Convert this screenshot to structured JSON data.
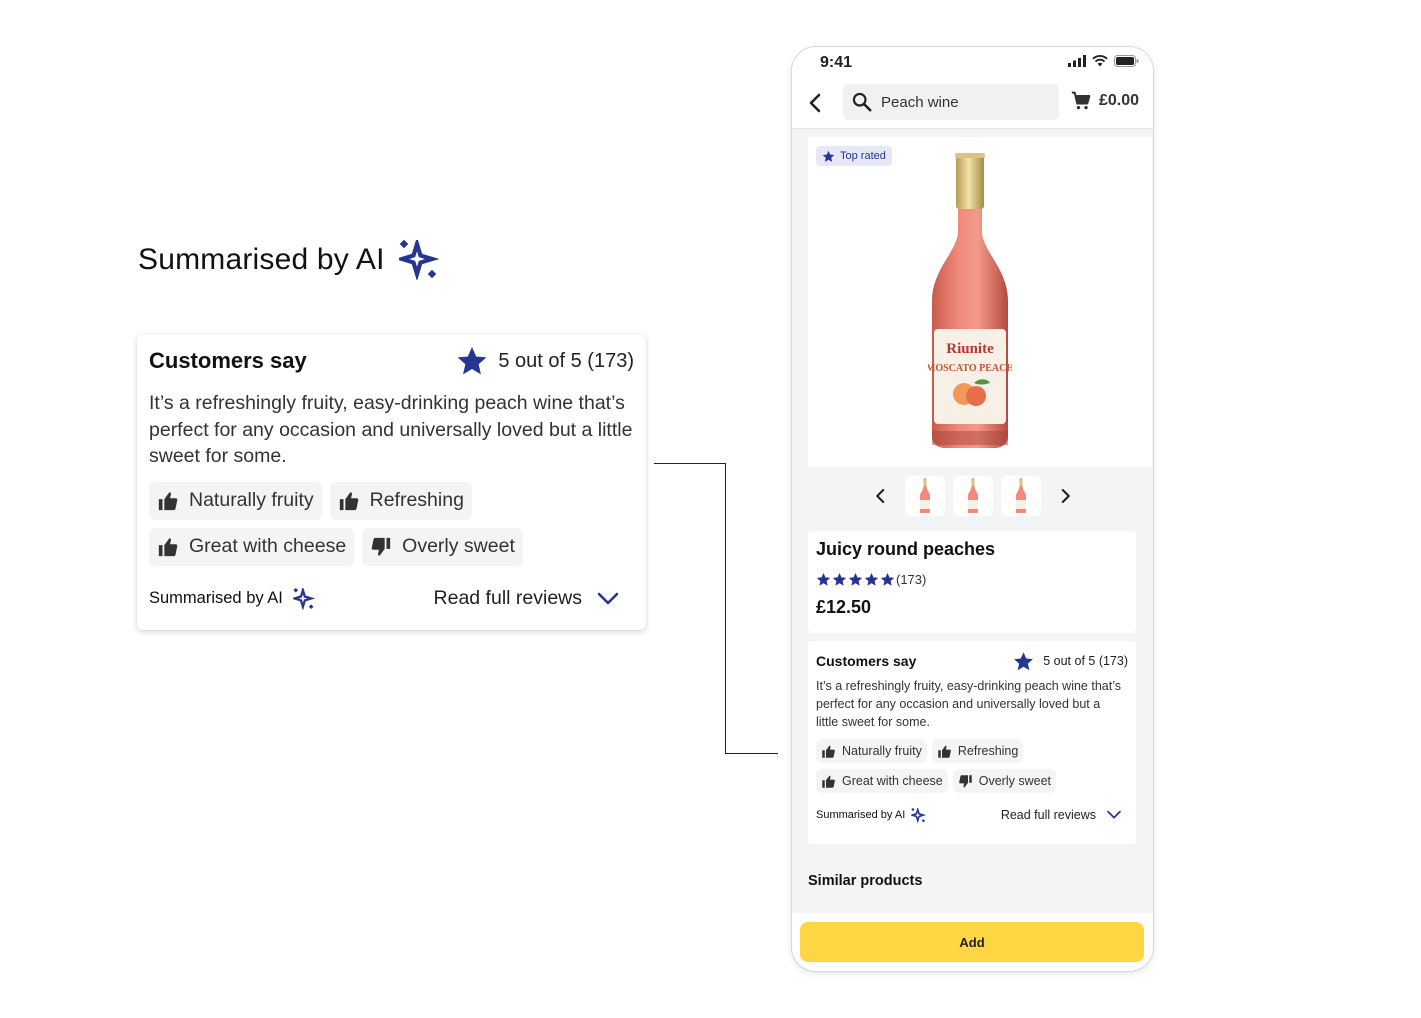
{
  "callout": {
    "heading": "Summarised by AI",
    "card": {
      "title": "Customers say",
      "rating_text": "5 out of 5 (173)",
      "summary": "It’s a refreshingly fruity, easy-drinking peach wine that’s perfect for any occasion and universally loved but a little sweet for some.",
      "chips": [
        {
          "label": "Naturally fruity",
          "icon": "thumbs-up-icon"
        },
        {
          "label": "Refreshing",
          "icon": "thumbs-up-icon"
        },
        {
          "label": "Great with cheese",
          "icon": "thumbs-up-icon"
        },
        {
          "label": "Overly sweet",
          "icon": "thumbs-down-icon"
        }
      ],
      "summarised_by": "Summarised by AI",
      "read_more": "Read full reviews"
    }
  },
  "phone": {
    "status_time": "9:41",
    "search": {
      "value": "Peach wine",
      "placeholder": "Peach wine"
    },
    "cart_total": "£0.00",
    "badge": "Top rated",
    "product": {
      "name": "Juicy round peaches",
      "rating": 5,
      "review_count": "(173)",
      "price": "£12.50",
      "bottle_brand": "Riunite",
      "bottle_variety": "MOSCATO PEACH"
    },
    "reviews": {
      "title": "Customers say",
      "rating_text": "5 out of 5 (173)",
      "summary": "It’s a refreshingly fruity, easy-drinking peach wine that’s perfect for any occasion and universally loved but a little sweet for some.",
      "chips": [
        {
          "label": "Naturally fruity",
          "icon": "thumbs-up-icon"
        },
        {
          "label": "Refreshing",
          "icon": "thumbs-up-icon"
        },
        {
          "label": "Great with cheese",
          "icon": "thumbs-up-icon"
        },
        {
          "label": "Overly sweet",
          "icon": "thumbs-down-icon"
        }
      ],
      "summarised_by": "Summarised by AI",
      "read_more": "Read full reviews"
    },
    "similar_heading": "Similar products",
    "add_label": "Add"
  },
  "colors": {
    "accent": "#263492",
    "add_button": "#FFD643",
    "page_bg": "#F3F4F6"
  }
}
